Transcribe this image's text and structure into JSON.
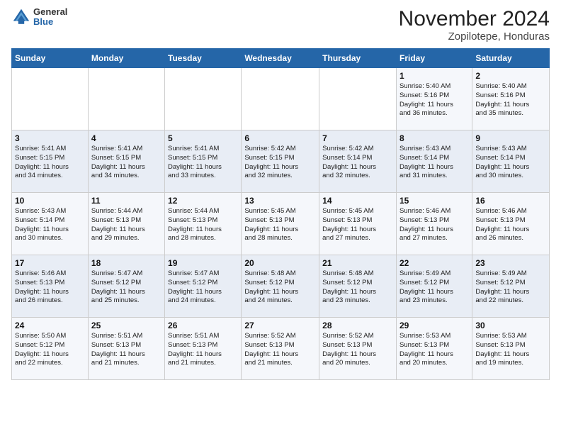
{
  "logo": {
    "general": "General",
    "blue": "Blue"
  },
  "title": "November 2024",
  "subtitle": "Zopilotepe, Honduras",
  "days_of_week": [
    "Sunday",
    "Monday",
    "Tuesday",
    "Wednesday",
    "Thursday",
    "Friday",
    "Saturday"
  ],
  "weeks": [
    [
      {
        "day": "",
        "info": ""
      },
      {
        "day": "",
        "info": ""
      },
      {
        "day": "",
        "info": ""
      },
      {
        "day": "",
        "info": ""
      },
      {
        "day": "",
        "info": ""
      },
      {
        "day": "1",
        "info": "Sunrise: 5:40 AM\nSunset: 5:16 PM\nDaylight: 11 hours\nand 36 minutes."
      },
      {
        "day": "2",
        "info": "Sunrise: 5:40 AM\nSunset: 5:16 PM\nDaylight: 11 hours\nand 35 minutes."
      }
    ],
    [
      {
        "day": "3",
        "info": "Sunrise: 5:41 AM\nSunset: 5:15 PM\nDaylight: 11 hours\nand 34 minutes."
      },
      {
        "day": "4",
        "info": "Sunrise: 5:41 AM\nSunset: 5:15 PM\nDaylight: 11 hours\nand 34 minutes."
      },
      {
        "day": "5",
        "info": "Sunrise: 5:41 AM\nSunset: 5:15 PM\nDaylight: 11 hours\nand 33 minutes."
      },
      {
        "day": "6",
        "info": "Sunrise: 5:42 AM\nSunset: 5:15 PM\nDaylight: 11 hours\nand 32 minutes."
      },
      {
        "day": "7",
        "info": "Sunrise: 5:42 AM\nSunset: 5:14 PM\nDaylight: 11 hours\nand 32 minutes."
      },
      {
        "day": "8",
        "info": "Sunrise: 5:43 AM\nSunset: 5:14 PM\nDaylight: 11 hours\nand 31 minutes."
      },
      {
        "day": "9",
        "info": "Sunrise: 5:43 AM\nSunset: 5:14 PM\nDaylight: 11 hours\nand 30 minutes."
      }
    ],
    [
      {
        "day": "10",
        "info": "Sunrise: 5:43 AM\nSunset: 5:14 PM\nDaylight: 11 hours\nand 30 minutes."
      },
      {
        "day": "11",
        "info": "Sunrise: 5:44 AM\nSunset: 5:13 PM\nDaylight: 11 hours\nand 29 minutes."
      },
      {
        "day": "12",
        "info": "Sunrise: 5:44 AM\nSunset: 5:13 PM\nDaylight: 11 hours\nand 28 minutes."
      },
      {
        "day": "13",
        "info": "Sunrise: 5:45 AM\nSunset: 5:13 PM\nDaylight: 11 hours\nand 28 minutes."
      },
      {
        "day": "14",
        "info": "Sunrise: 5:45 AM\nSunset: 5:13 PM\nDaylight: 11 hours\nand 27 minutes."
      },
      {
        "day": "15",
        "info": "Sunrise: 5:46 AM\nSunset: 5:13 PM\nDaylight: 11 hours\nand 27 minutes."
      },
      {
        "day": "16",
        "info": "Sunrise: 5:46 AM\nSunset: 5:13 PM\nDaylight: 11 hours\nand 26 minutes."
      }
    ],
    [
      {
        "day": "17",
        "info": "Sunrise: 5:46 AM\nSunset: 5:13 PM\nDaylight: 11 hours\nand 26 minutes."
      },
      {
        "day": "18",
        "info": "Sunrise: 5:47 AM\nSunset: 5:12 PM\nDaylight: 11 hours\nand 25 minutes."
      },
      {
        "day": "19",
        "info": "Sunrise: 5:47 AM\nSunset: 5:12 PM\nDaylight: 11 hours\nand 24 minutes."
      },
      {
        "day": "20",
        "info": "Sunrise: 5:48 AM\nSunset: 5:12 PM\nDaylight: 11 hours\nand 24 minutes."
      },
      {
        "day": "21",
        "info": "Sunrise: 5:48 AM\nSunset: 5:12 PM\nDaylight: 11 hours\nand 23 minutes."
      },
      {
        "day": "22",
        "info": "Sunrise: 5:49 AM\nSunset: 5:12 PM\nDaylight: 11 hours\nand 23 minutes."
      },
      {
        "day": "23",
        "info": "Sunrise: 5:49 AM\nSunset: 5:12 PM\nDaylight: 11 hours\nand 22 minutes."
      }
    ],
    [
      {
        "day": "24",
        "info": "Sunrise: 5:50 AM\nSunset: 5:12 PM\nDaylight: 11 hours\nand 22 minutes."
      },
      {
        "day": "25",
        "info": "Sunrise: 5:51 AM\nSunset: 5:13 PM\nDaylight: 11 hours\nand 21 minutes."
      },
      {
        "day": "26",
        "info": "Sunrise: 5:51 AM\nSunset: 5:13 PM\nDaylight: 11 hours\nand 21 minutes."
      },
      {
        "day": "27",
        "info": "Sunrise: 5:52 AM\nSunset: 5:13 PM\nDaylight: 11 hours\nand 21 minutes."
      },
      {
        "day": "28",
        "info": "Sunrise: 5:52 AM\nSunset: 5:13 PM\nDaylight: 11 hours\nand 20 minutes."
      },
      {
        "day": "29",
        "info": "Sunrise: 5:53 AM\nSunset: 5:13 PM\nDaylight: 11 hours\nand 20 minutes."
      },
      {
        "day": "30",
        "info": "Sunrise: 5:53 AM\nSunset: 5:13 PM\nDaylight: 11 hours\nand 19 minutes."
      }
    ]
  ]
}
